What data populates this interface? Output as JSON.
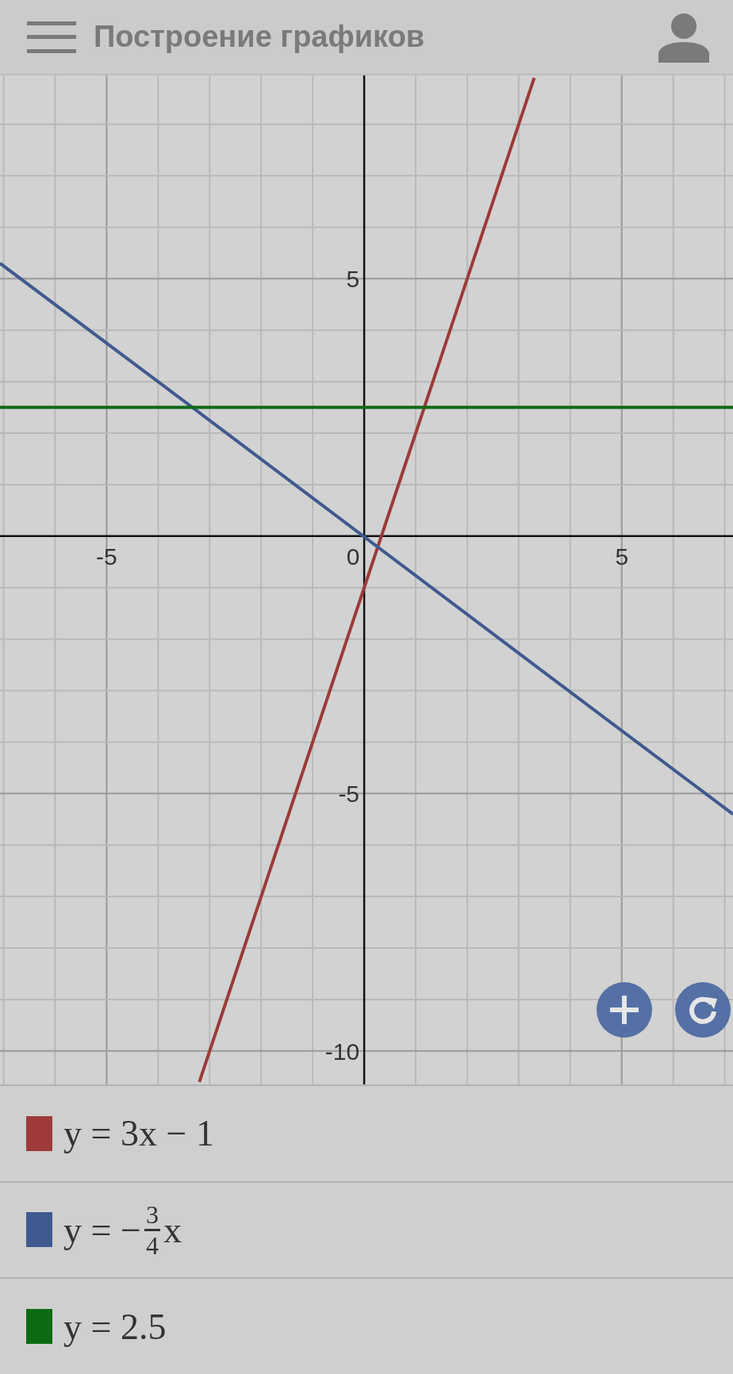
{
  "app_bar": {
    "title": "Построение графиков"
  },
  "graph": {
    "chart_data": {
      "type": "line",
      "x": [
        -7.07,
        -3.2,
        3.3,
        7.16
      ],
      "xlim": [
        -7.07,
        7.16
      ],
      "ylim": [
        -10.65,
        8.95
      ],
      "grid": true,
      "xticks": [
        -5,
        0,
        5
      ],
      "yticks": [
        -10,
        -5,
        5
      ],
      "series": [
        {
          "color": "#9e3a3a",
          "values": [
            null,
            -10.6,
            8.9,
            null
          ]
        },
        {
          "color": "#3f5a8f",
          "values": [
            5.3,
            2.4,
            -2.5,
            -5.4
          ]
        },
        {
          "color": "#0b6b12",
          "values": [
            2.5,
            2.5,
            2.5,
            2.5
          ]
        }
      ]
    }
  },
  "expressions": [
    {
      "kind": "plain",
      "color": "#9e3a3a",
      "text": "y = 3x − 1"
    },
    {
      "kind": "fraction",
      "color": "#3f5a8f",
      "before": "y = −",
      "numerator": "3",
      "denominator": "4",
      "after": "x"
    },
    {
      "kind": "plain",
      "color": "#0b6b12",
      "text": "y = 2.5"
    }
  ]
}
